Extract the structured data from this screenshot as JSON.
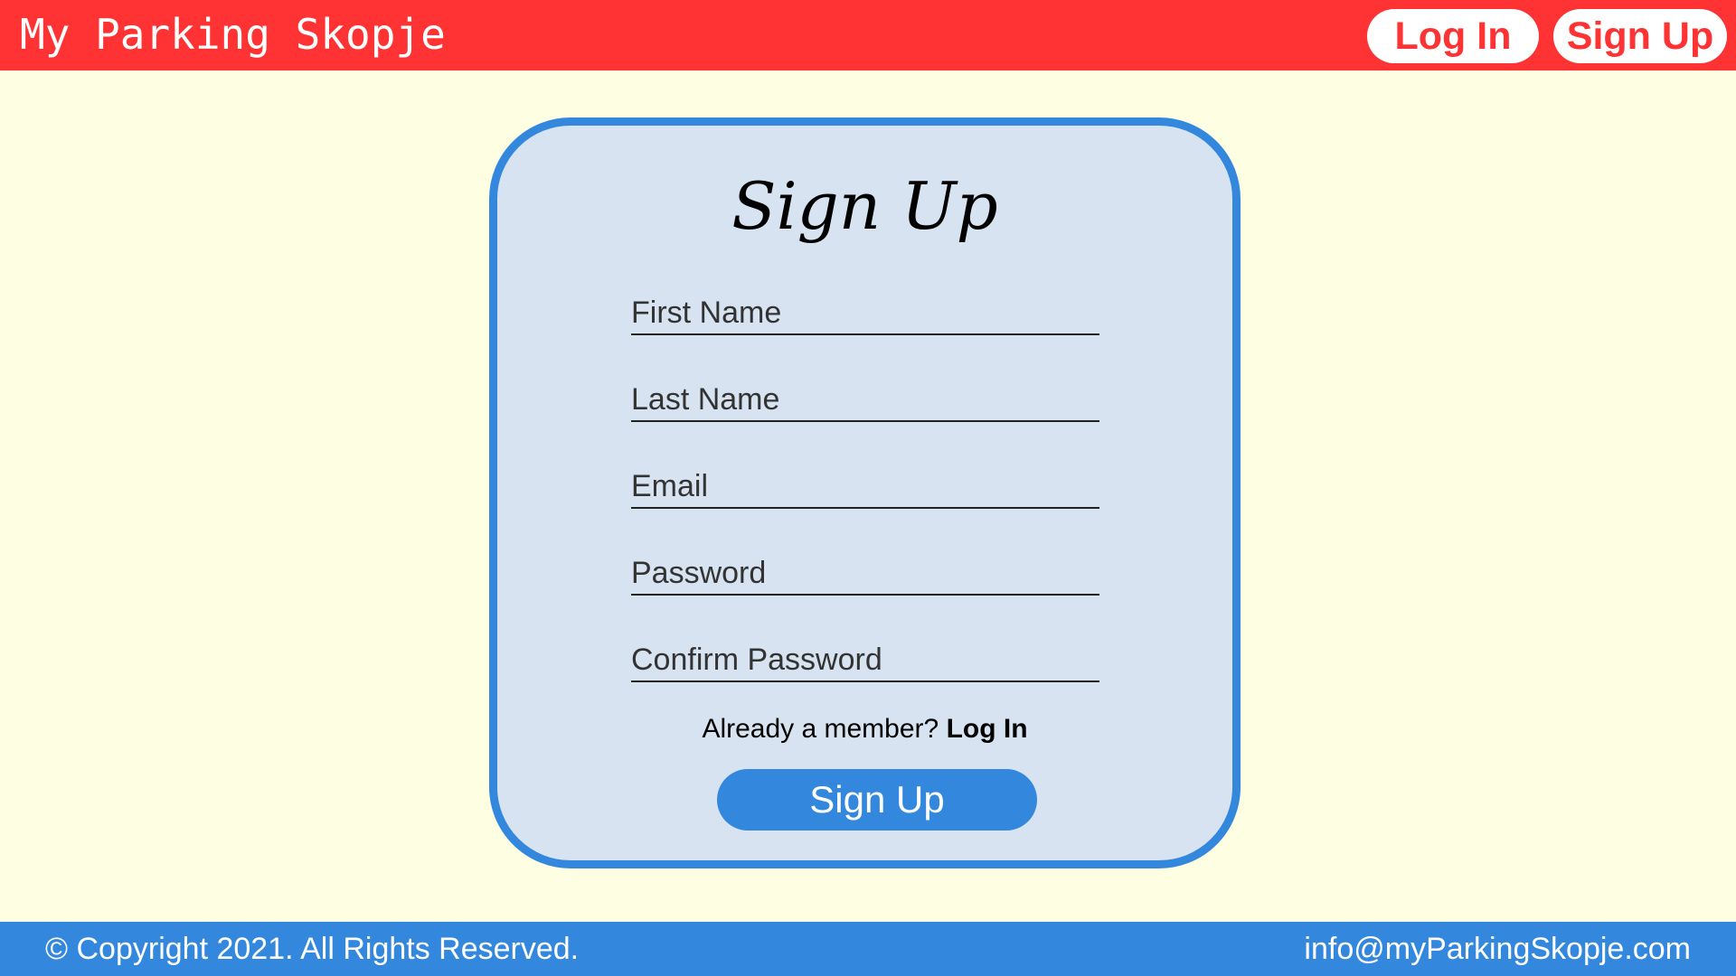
{
  "colors": {
    "page_background": "#FEFFE2",
    "header_background": "#FF3333",
    "footer_background": "#3388DD",
    "card_background": "#D7E3F1",
    "card_border": "#3388DD",
    "primary_button": "#3388DD"
  },
  "header": {
    "brand": "My Parking Skopje",
    "login_label": "Log In",
    "signup_label": "Sign Up"
  },
  "form": {
    "title": "Sign Up",
    "fields": [
      {
        "label": "First Name"
      },
      {
        "label": "Last Name"
      },
      {
        "label": "Email"
      },
      {
        "label": "Password"
      },
      {
        "label": "Confirm Password"
      }
    ],
    "member_prompt": "Already a member?",
    "member_link": "Log In",
    "submit_label": "Sign Up"
  },
  "footer": {
    "copyright": "© Copyright 2021. All Rights Reserved.",
    "email": "info@myParkingSkopje.com"
  }
}
